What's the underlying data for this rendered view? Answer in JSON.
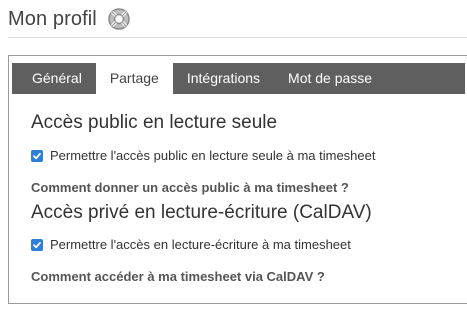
{
  "header": {
    "title": "Mon profil",
    "help_icon": "lifebuoy-icon"
  },
  "tabs": [
    {
      "label": "Général",
      "active": false
    },
    {
      "label": "Partage",
      "active": true
    },
    {
      "label": "Intégrations",
      "active": false
    },
    {
      "label": "Mot de passe",
      "active": false
    }
  ],
  "public_access": {
    "title": "Accès public en lecture seule",
    "checkbox_label": "Permettre l'accès public en lecture seule à ma timesheet",
    "checked": true,
    "help_link": "Comment donner un accès public à ma timesheet ?"
  },
  "private_access": {
    "title": "Accès privé en lecture-écriture (CalDAV)",
    "checkbox_label": "Permettre l'accès en lecture-écriture à ma timesheet",
    "checked": true,
    "help_link": "Comment accéder à ma timesheet via CalDAV ?"
  },
  "colors": {
    "tabbar": "#5f5f5f",
    "checkbox": "#2f7fd8"
  }
}
